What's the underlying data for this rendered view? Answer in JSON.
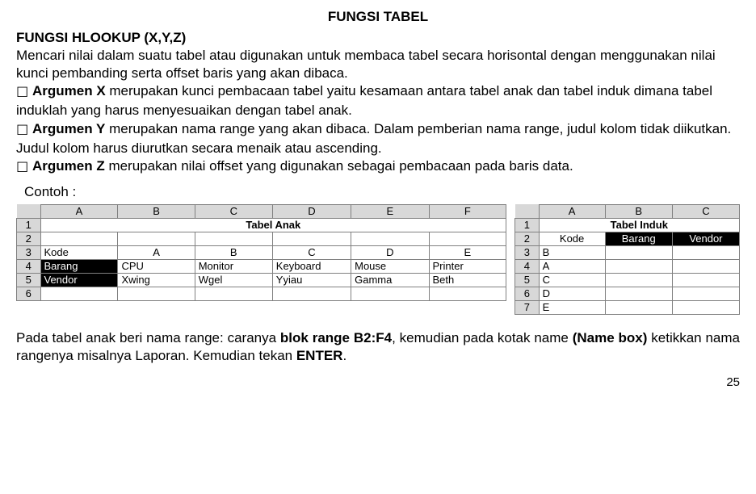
{
  "title": "FUNGSI TABEL",
  "heading": "FUNGSI HLOOKUP (X,Y,Z)",
  "intro": "Mencari nilai dalam suatu tabel atau digunakan untuk membaca tabel secara horisontal dengan menggunakan nilai kunci pembanding serta offset baris yang akan dibaca.",
  "bullet_glyph": "☐",
  "argX": {
    "label": "Argumen X",
    "text": " merupakan kunci pembacaan tabel yaitu kesamaan antara tabel anak dan tabel induk dimana tabel induklah yang harus menyesuaikan dengan tabel anak."
  },
  "argY": {
    "label": "Argumen Y",
    "text": " merupakan nama range yang akan dibaca. Dalam pemberian nama range, judul kolom tidak diikutkan. Judul kolom harus diurutkan secara menaik atau ascending."
  },
  "argZ": {
    "label": "Argumen Z",
    "text": " merupakan nilai offset yang digunakan sebagai pembacaan pada baris data."
  },
  "contoh_label": "Contoh :",
  "table_anak": {
    "cols": [
      "A",
      "B",
      "C",
      "D",
      "E",
      "F"
    ],
    "rows": [
      "1",
      "2",
      "3",
      "4",
      "5",
      "6"
    ],
    "title": "Tabel Anak",
    "data": {
      "r3": [
        "Kode",
        "A",
        "B",
        "C",
        "D",
        "E"
      ],
      "r4": [
        "Barang",
        "CPU",
        "Monitor",
        "Keyboard",
        "Mouse",
        "Printer"
      ],
      "r5": [
        "Vendor",
        "Xwing",
        "Wgel",
        "Yyiau",
        "Gamma",
        "Beth"
      ]
    }
  },
  "table_induk": {
    "cols": [
      "A",
      "B",
      "C"
    ],
    "rows": [
      "1",
      "2",
      "3",
      "4",
      "5",
      "6",
      "7"
    ],
    "title": "Tabel Induk",
    "header2": [
      "Kode",
      "Barang",
      "Vendor"
    ],
    "codes": [
      "B",
      "A",
      "C",
      "D",
      "E"
    ]
  },
  "bottom": {
    "t1": "Pada tabel anak beri nama range: caranya ",
    "b1": "blok range B2:F4",
    "t2": ", kemudian pada kotak name ",
    "b2": "(Name box)",
    "t3": " ketikkan nama rangenya misalnya Laporan. Kemudian tekan ",
    "b3": "ENTER",
    "t4": "."
  },
  "page_number": "25"
}
